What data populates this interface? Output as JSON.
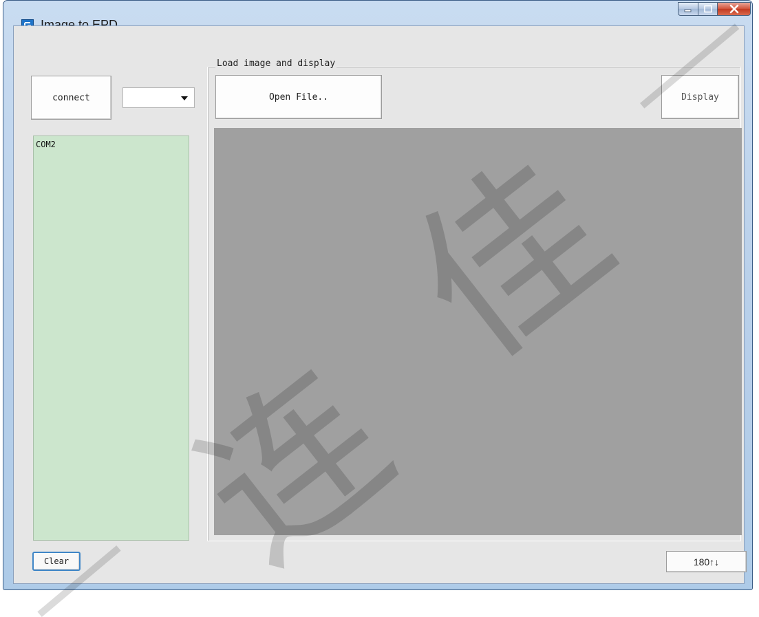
{
  "window": {
    "title": "Image to EPD"
  },
  "left_panel": {
    "connect_label": "connect",
    "port_select_value": "",
    "ports": [
      "COM2"
    ],
    "clear_label": "Clear"
  },
  "main": {
    "group_title": "Load image and display",
    "open_label": "Open File..",
    "display_label": "Display",
    "rotate_label": "180↑↓"
  },
  "watermark": {
    "chars": [
      "佳",
      "连"
    ]
  }
}
